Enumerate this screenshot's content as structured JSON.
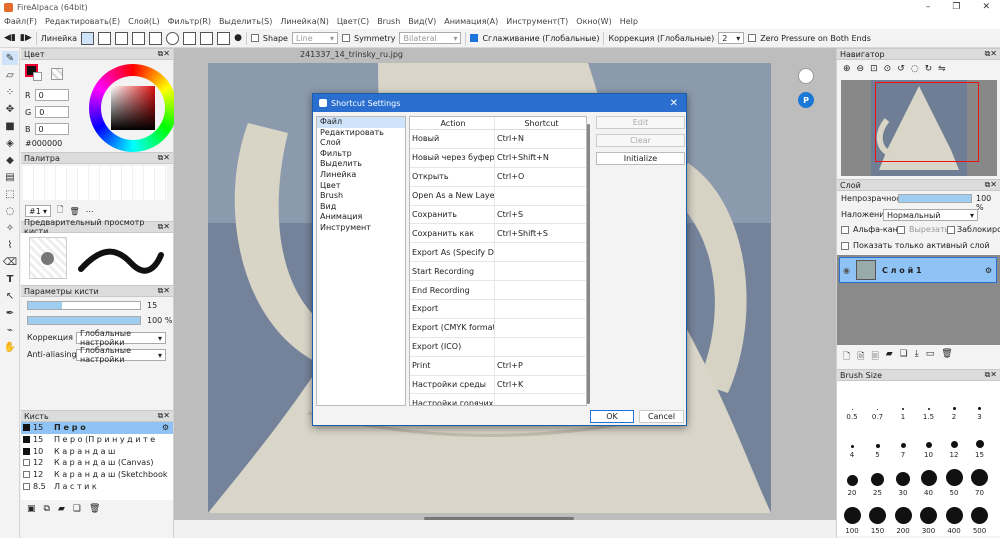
{
  "window": {
    "title": "FireAlpaca (64bit)"
  },
  "menu": [
    "Файл(F)",
    "Редактировать(E)",
    "Слой(L)",
    "Фильтр(R)",
    "Выделить(S)",
    "Линейка(N)",
    "Цвет(C)",
    "Brush",
    "Вид(V)",
    "Анимация(A)",
    "Инструмент(T)",
    "Окно(W)",
    "Help"
  ],
  "toolbar": {
    "ruler_label": "Линейка",
    "shape_label": "Shape",
    "shape_value": "Line",
    "symmetry_label": "Symmetry",
    "symmetry_value": "Bilateral",
    "smoothing_label": "Сглаживание (Глобальные)",
    "correction_label": "Коррекция (Глобальные)",
    "correction_value": "2",
    "zero_pressure_label": "Zero Pressure on Both Ends"
  },
  "color_panel": {
    "title": "Цвет",
    "r_label": "R",
    "r_value": "0",
    "g_label": "G",
    "g_value": "0",
    "b_label": "B",
    "b_value": "0",
    "hex": "#000000"
  },
  "palette_panel": {
    "title": "Палитра",
    "selector": "#1"
  },
  "brush_preview_panel": {
    "title": "Предварительный просмотр кисти"
  },
  "brush_params_panel": {
    "title": "Параметры кисти",
    "size_value": "15",
    "size_fraction": 0.3,
    "opacity_value": "100 %",
    "opacity_fraction": 1.0,
    "correction_label": "Коррекция",
    "correction_value": "Глобальные настройки",
    "antialias_label": "Anti-aliasing",
    "antialias_value": "Глобальные настройки"
  },
  "brush_panel": {
    "title": "Кисть",
    "items": [
      {
        "size": "15",
        "name": "П е р о",
        "selected": true,
        "black": true
      },
      {
        "size": "15",
        "name": "П е р о (П р и н у д и т е",
        "selected": false,
        "black": true
      },
      {
        "size": "10",
        "name": "К а р а н д а ш",
        "selected": false,
        "black": true
      },
      {
        "size": "12",
        "name": "К а р а н д а ш (Canvas)",
        "selected": false,
        "black": false
      },
      {
        "size": "12",
        "name": "К а р а н д а ш (Sketchbook",
        "selected": false,
        "black": false
      },
      {
        "size": "8.5",
        "name": "Л а с т и к",
        "selected": false,
        "black": false
      }
    ]
  },
  "canvas_tab": {
    "filename": "241337_14_trinsky_ru.jpg"
  },
  "dialog": {
    "title": "Shortcut Settings",
    "categories": [
      "Файл",
      "Редактировать",
      "Слой",
      "Фильтр",
      "Выделить",
      "Линейка",
      "Цвет",
      "Brush",
      "Вид",
      "Анимация",
      "Инструмент"
    ],
    "selected_category": "Файл",
    "col_action": "Action",
    "col_shortcut": "Shortcut",
    "rows": [
      {
        "action": "Новый",
        "shortcut": "Ctrl+N"
      },
      {
        "action": "Новый через буфер о...",
        "shortcut": "Ctrl+Shift+N"
      },
      {
        "action": "Открыть",
        "shortcut": "Ctrl+O"
      },
      {
        "action": "Open As a New Layer",
        "shortcut": ""
      },
      {
        "action": "Сохранить",
        "shortcut": "Ctrl+S"
      },
      {
        "action": "Сохранить как",
        "shortcut": "Ctrl+Shift+S"
      },
      {
        "action": "Export As (Specify Date)",
        "shortcut": ""
      },
      {
        "action": "Start Recording",
        "shortcut": ""
      },
      {
        "action": "End Recording",
        "shortcut": ""
      },
      {
        "action": "Export",
        "shortcut": ""
      },
      {
        "action": "Export (CMYK format ...",
        "shortcut": ""
      },
      {
        "action": "Export (ICO)",
        "shortcut": ""
      },
      {
        "action": "Print",
        "shortcut": "Ctrl+P"
      },
      {
        "action": "Настройки среды",
        "shortcut": "Ctrl+K"
      },
      {
        "action": "Настройки горячих к...",
        "shortcut": ""
      }
    ],
    "edit_label": "Edit",
    "clear_label": "Clear",
    "initialize_label": "Initialize",
    "ok_label": "OK",
    "cancel_label": "Cancel"
  },
  "navigator": {
    "title": "Навигатор"
  },
  "layer_panel": {
    "title": "Слой",
    "opacity_label": "Непрозрачность",
    "opacity_value": "100 %",
    "opacity_fraction": 1.0,
    "blend_label": "Наложение",
    "blend_value": "Нормальный",
    "alpha_label": "Альфа-кана",
    "clip_label": "Вырезать",
    "lock_label": "Заблокирова",
    "show_active_label": "Показать только активный слой",
    "layer_name": "С л о й 1"
  },
  "brush_size_panel": {
    "title": "Brush Size",
    "sizes": [
      "0.5",
      "0.7",
      "1",
      "1.5",
      "2",
      "3",
      "4",
      "5",
      "7",
      "10",
      "12",
      "15",
      "20",
      "25",
      "30",
      "40",
      "50",
      "70",
      "100",
      "150",
      "200",
      "300",
      "400",
      "500"
    ]
  },
  "colors": {
    "accent": "#2a6fd0",
    "selection": "#cfe3fb",
    "selected_row": "#8fc3f5"
  }
}
